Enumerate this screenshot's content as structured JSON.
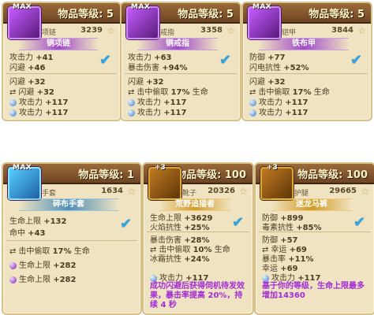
{
  "cards": [
    {
      "level_label": "物品等级: 5",
      "max": "MAX",
      "type": "项链",
      "score": "3239",
      "name": "铜项链",
      "stats": [
        {
          "label": "攻击力",
          "value": "+41"
        },
        {
          "label": "闪避",
          "value": "+46"
        },
        {
          "label": "闪避",
          "value": "+32"
        }
      ],
      "sub": [
        {
          "label": "闪避",
          "value": "+32"
        },
        {
          "label": "攻击力",
          "value": "+117"
        },
        {
          "label": "攻击力",
          "value": "+117"
        }
      ]
    },
    {
      "level_label": "物品等级: 5",
      "max": "MAX",
      "type": "戒指",
      "score": "3358",
      "name": "铜戒指",
      "stats": [
        {
          "label": "攻击力",
          "value": "+63"
        },
        {
          "label": "暴击伤害",
          "value": "+94%"
        },
        {
          "label": "闪避",
          "value": "+32"
        }
      ],
      "sub": [
        {
          "label": "击中偷取",
          "value": "17%",
          "suffix": "生命"
        },
        {
          "label": "攻击力",
          "value": "+117"
        },
        {
          "label": "攻击力",
          "value": "+117"
        }
      ]
    },
    {
      "level_label": "物品等级: 5",
      "max": "MAX",
      "type": "铠甲",
      "score": "3844",
      "name": "铁布甲",
      "stats": [
        {
          "label": "防御",
          "value": "+77"
        },
        {
          "label": "闪电抗性",
          "value": "+52%"
        },
        {
          "label": "闪避",
          "value": "+32"
        }
      ],
      "sub": [
        {
          "label": "击中偷取",
          "value": "17%",
          "suffix": "生命"
        },
        {
          "label": "攻击力",
          "value": "+117"
        },
        {
          "label": "攻击力",
          "value": "+117"
        }
      ]
    },
    {
      "level_label": "物品等级: 1",
      "max": "MAX",
      "type": "手套",
      "score": "1634",
      "name": "碎布手套",
      "stats": [
        {
          "label": "生命上限",
          "value": "+132"
        },
        {
          "label": "命中",
          "value": "+43"
        }
      ],
      "sub": [
        {
          "label": "击中偷取",
          "value": "17%",
          "suffix": "生命"
        },
        {
          "label": "生命上限",
          "value": "+282"
        },
        {
          "label": "生命上限",
          "value": "+282"
        }
      ]
    },
    {
      "level_label": "物品等级: 100",
      "plus": "+3",
      "type": "靴子",
      "score": "20326",
      "name": "荒野追猎者",
      "stats": [
        {
          "label": "生命上限",
          "value": "+3629"
        },
        {
          "label": "火焰抗性",
          "value": "+25%"
        },
        {
          "label": "暴击伤害",
          "value": "+28%"
        },
        {
          "label": "击中偷取",
          "value": "10%",
          "suffix": "生命"
        },
        {
          "label": "冰霜抗性",
          "value": "+24%"
        },
        {
          "label": "",
          "value": ""
        },
        {
          "label": "攻击力",
          "value": "+117"
        }
      ],
      "desc": "成功闪避后获得伺机待发效果，暴击率提高 20%，持续 4 秒"
    },
    {
      "level_label": "物品等级: 100",
      "plus": "+3",
      "type": "护腿",
      "score": "29665",
      "name": "迷龙马裤",
      "stats": [
        {
          "label": "防御",
          "value": "+899"
        },
        {
          "label": "毒素抗性",
          "value": "+85%"
        },
        {
          "label": "防御",
          "value": "+57"
        },
        {
          "label": "幸运",
          "value": "+69"
        },
        {
          "label": "暴击率",
          "value": "+11%"
        },
        {
          "label": "幸运",
          "value": "+69"
        },
        {
          "label": "攻击力",
          "value": "+117"
        }
      ],
      "desc": "基于你的等级，生命上限最多增加14360"
    }
  ]
}
